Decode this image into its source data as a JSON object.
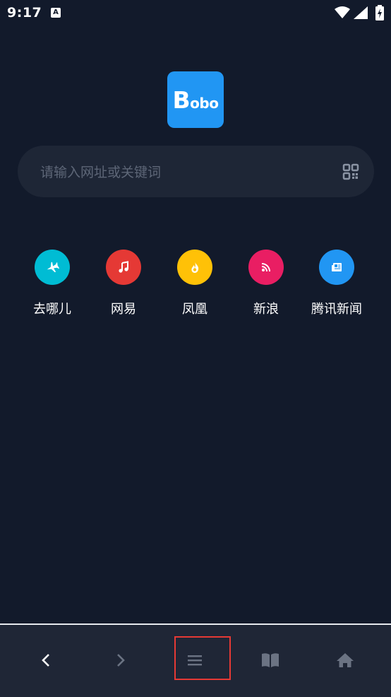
{
  "status_bar": {
    "time": "9:17",
    "notification_badge": "A"
  },
  "logo": {
    "big_letter": "B",
    "rest": "obo",
    "color": "#2196f3"
  },
  "search": {
    "placeholder": "请输入网址或关键词",
    "value": ""
  },
  "shortcuts": [
    {
      "label": "去哪儿",
      "icon": "airplane-icon",
      "color": "#00bcd4"
    },
    {
      "label": "网易",
      "icon": "music-note-icon",
      "color": "#e53935"
    },
    {
      "label": "凤凰",
      "icon": "flame-icon",
      "color": "#ffc107"
    },
    {
      "label": "新浪",
      "icon": "rss-icon",
      "color": "#e91e63"
    },
    {
      "label": "腾讯新闻",
      "icon": "newspaper-icon",
      "color": "#2196f3"
    }
  ],
  "bottom_nav": {
    "items": [
      "back-icon",
      "forward-icon",
      "menu-icon",
      "bookmarks-icon",
      "home-icon"
    ],
    "highlighted": "menu-icon",
    "highlight_color": "#e53935"
  }
}
